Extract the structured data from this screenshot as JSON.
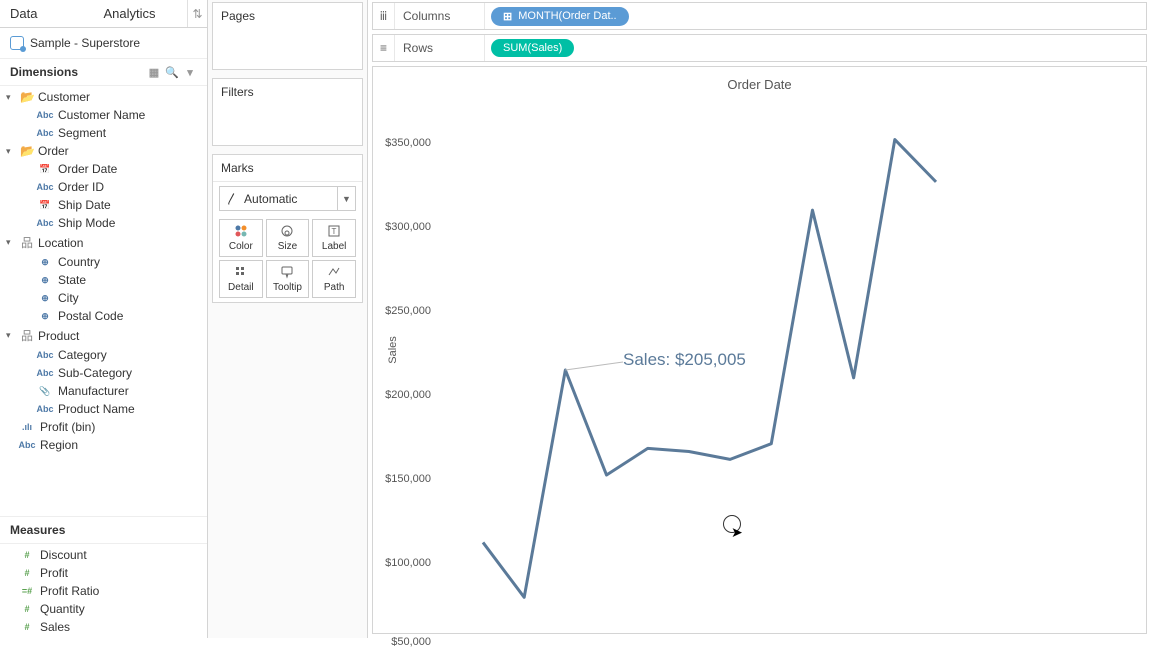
{
  "tabs": {
    "data": "Data",
    "analytics": "Analytics"
  },
  "datasource": "Sample - Superstore",
  "sections": {
    "dimensions": "Dimensions",
    "measures": "Measures"
  },
  "tree": {
    "customer": {
      "label": "Customer",
      "name": "Customer Name",
      "segment": "Segment"
    },
    "order": {
      "label": "Order",
      "order_date": "Order Date",
      "order_id": "Order ID",
      "ship_date": "Ship Date",
      "ship_mode": "Ship Mode"
    },
    "location": {
      "label": "Location",
      "country": "Country",
      "state": "State",
      "city": "City",
      "postal": "Postal Code"
    },
    "product": {
      "label": "Product",
      "category": "Category",
      "subcat": "Sub-Category",
      "manuf": "Manufacturer",
      "pname": "Product Name"
    },
    "profit_bin": "Profit (bin)",
    "region": "Region"
  },
  "measures": {
    "discount": "Discount",
    "profit": "Profit",
    "profit_ratio": "Profit Ratio",
    "quantity": "Quantity",
    "sales": "Sales"
  },
  "shelves": {
    "pages": "Pages",
    "filters": "Filters",
    "marks": "Marks",
    "columns": "Columns",
    "rows": "Rows"
  },
  "marks": {
    "type": "Automatic",
    "cells": {
      "color": "Color",
      "size": "Size",
      "label": "Label",
      "detail": "Detail",
      "tooltip": "Tooltip",
      "path": "Path"
    }
  },
  "pills": {
    "columns": "MONTH(Order Dat..",
    "rows": "SUM(Sales)"
  },
  "chart": {
    "title": "Order Date",
    "ylabel": "Sales",
    "annotation": "Sales: $205,005",
    "y_ticks": [
      "$350,000",
      "$300,000",
      "$250,000",
      "$200,000",
      "$150,000",
      "$100,000",
      "$50,000"
    ]
  },
  "chart_data": {
    "type": "line",
    "title": "Order Date",
    "xlabel": "Order Date (Month)",
    "ylabel": "Sales",
    "ylim": [
      50000,
      360000
    ],
    "x": [
      1,
      2,
      3,
      4,
      5,
      6,
      7,
      8,
      9,
      10,
      11,
      12
    ],
    "series": [
      {
        "name": "Sales",
        "values": [
          95000,
          60000,
          205005,
          138000,
          155000,
          153000,
          148000,
          158000,
          307000,
          200000,
          352000,
          325000
        ]
      }
    ],
    "annotations": [
      {
        "text": "Sales: $205,005",
        "x": 3,
        "y": 205005
      }
    ]
  }
}
